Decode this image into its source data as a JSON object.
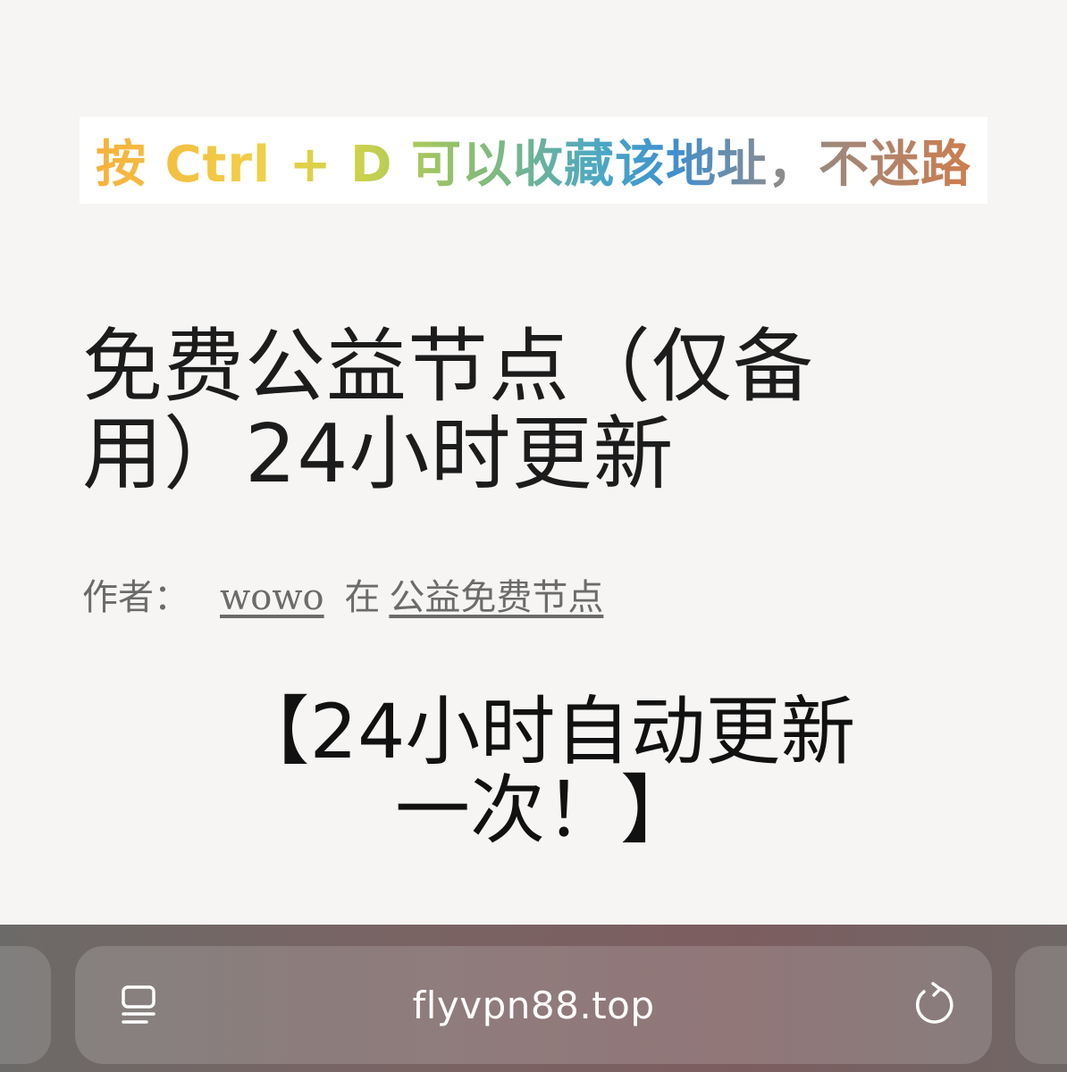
{
  "banner": {
    "text": "按 Ctrl + D 可以收藏该地址，不迷路"
  },
  "post": {
    "title": "免费公益节点（仅备用）24小时更新",
    "byline_label": "作者：",
    "author": "wowo",
    "byline_in": "在",
    "category": "公益免费节点",
    "headline": "【24小时自动更新一次！】"
  },
  "browser": {
    "url": "flyvpn88.top",
    "icons": {
      "reader": "reader-mode-icon",
      "reload": "reload-icon"
    }
  }
}
